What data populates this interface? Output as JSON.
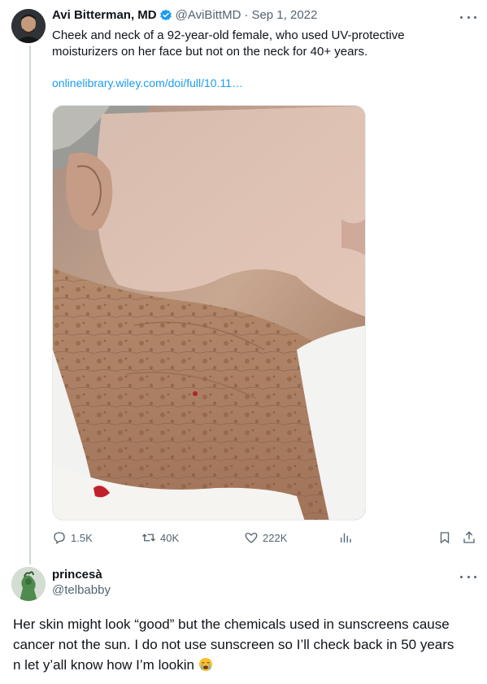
{
  "tweet": {
    "author_name": "Avi Bitterman, MD",
    "handle": "@AviBittMD",
    "separator": "·",
    "date": "Sep 1, 2022",
    "text": "Cheek and neck of a 92-year-old female, who used UV-protective\nmoisturizers on her face but not on the neck for 40+ years.",
    "link": "onlinelibrary.wiley.com/doi/full/10.11…",
    "verified_icon": "verified-badge-icon",
    "image_label": "photo of aged cheek and neck skin",
    "actions": {
      "replies": "1.5K",
      "reposts": "40K",
      "likes": "222K"
    },
    "icons": {
      "reply": "reply-icon",
      "repost": "repost-icon",
      "like": "heart-icon",
      "views": "views-icon",
      "bookmark": "bookmark-icon",
      "share": "share-icon",
      "more": "more-icon"
    }
  },
  "reply": {
    "author_name": "princesà",
    "handle": "@telbabby",
    "text": "Her skin might look “good” but the chemicals used in sunscreens cause\ncancer not the sun. I do not use sunscreen so I’ll check back in 50 years\nn let y’all know how I’m lookin",
    "emoji": "crying-face-emoji"
  },
  "colors": {
    "link": "#1d9bf0",
    "verified": "#1d9bf0",
    "secondary_text": "#536471",
    "thread_line": "#cfd9de"
  }
}
